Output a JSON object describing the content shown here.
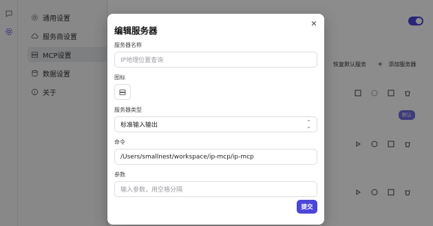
{
  "background": {
    "nav": [
      {
        "label": "通用设置",
        "icon": "gear-icon"
      },
      {
        "label": "服务商设置",
        "icon": "cloud-icon"
      },
      {
        "label": "MCP设置",
        "icon": "server-icon"
      },
      {
        "label": "数据设置",
        "icon": "database-icon"
      },
      {
        "label": "关于",
        "icon": "info-icon"
      }
    ],
    "restore_default_label": "恢复默认服务",
    "add_server_label": "添加服务器",
    "badge_label": "默认"
  },
  "modal": {
    "title": "编辑服务器",
    "name_label": "服务器名称",
    "name_placeholder": "IP地理位置查询",
    "icon_label": "图标",
    "type_label": "服务器类型",
    "type_value": "标准输入输出",
    "command_label": "命令",
    "command_value": "/Users/smallnest/workspace/ip-mcp/ip-mcp",
    "args_label": "参数",
    "args_placeholder": "输入参数，用空格分隔",
    "submit_label": "提交"
  },
  "colors": {
    "accent": "#4b45d8",
    "overlay": "rgba(0,0,0,0.45)"
  }
}
